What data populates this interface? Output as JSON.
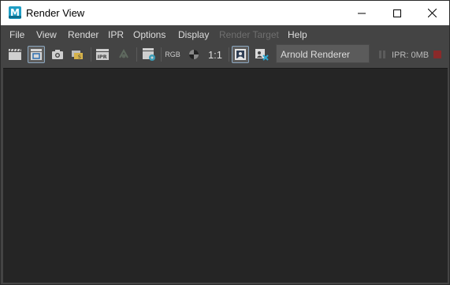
{
  "window": {
    "title": "Render View",
    "app_icon_letter": "M",
    "controls": {
      "minimize": "minimize",
      "maximize": "maximize",
      "close": "close"
    }
  },
  "menubar": {
    "items": [
      {
        "label": "File",
        "enabled": true
      },
      {
        "label": "View",
        "enabled": true
      },
      {
        "label": "Render",
        "enabled": true
      },
      {
        "label": "IPR",
        "enabled": true
      },
      {
        "label": "Options",
        "enabled": true
      },
      {
        "label": "Display",
        "enabled": true
      },
      {
        "label": "Render Target",
        "enabled": false
      },
      {
        "label": "Help",
        "enabled": true
      }
    ]
  },
  "toolbar": {
    "icons": [
      "render-clapper-icon",
      "render-region-icon",
      "snapshot-camera-icon",
      "render-sequence-icon",
      "ipr-render-icon",
      "refresh-ipr-icon",
      "render-settings-icon",
      "rgb-channel-icon",
      "alpha-channel-icon",
      "one-to-one-icon",
      "keep-image-icon",
      "remove-image-icon",
      "pause-ipr-icon",
      "stop-ipr-icon"
    ],
    "rgb_label": "RGB",
    "ratio_label": "1:1",
    "renderer": "Arnold Renderer",
    "ipr_memory": "IPR: 0MB"
  },
  "colors": {
    "window_bg": "#444444",
    "viewport_bg": "#252525",
    "titlebar_bg": "#ffffff",
    "accent": "#1f9ec5",
    "stop_red": "#8a2a2a"
  }
}
